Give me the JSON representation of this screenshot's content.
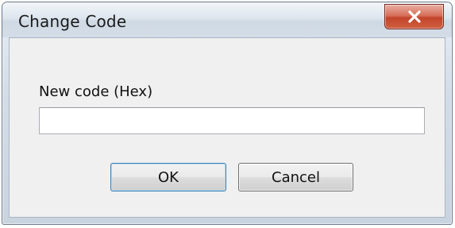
{
  "window": {
    "title": "Change Code",
    "close_icon": "close-icon"
  },
  "form": {
    "code_label": "New code (Hex)",
    "code_value": "",
    "code_placeholder": ""
  },
  "buttons": {
    "ok_label": "OK",
    "cancel_label": "Cancel"
  },
  "colors": {
    "close_button": "#c4442b",
    "client_background": "#f0f0f0",
    "default_button_border": "#3c7fb1"
  }
}
